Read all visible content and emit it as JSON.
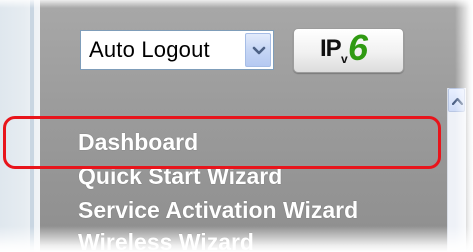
{
  "header": {
    "auto_logout": {
      "selected_value": "Auto Logout"
    },
    "ipv6_button": {
      "text_ip": "IP",
      "text_v": "v",
      "text_six": "6"
    }
  },
  "menu": {
    "items": [
      {
        "label": "Dashboard",
        "highlighted": true
      },
      {
        "label": "Quick Start Wizard"
      },
      {
        "label": "Service Activation Wizard"
      },
      {
        "label": "Wireless Wizard"
      }
    ]
  },
  "colors": {
    "panel": "#9b9b9b",
    "highlight": "#e8141b",
    "ipv6_six": "#2f9a12",
    "menu_text": "#ffffff"
  },
  "icons": {
    "select_arrow": "chevron-down-icon",
    "scroll_up": "chevron-up-icon"
  }
}
